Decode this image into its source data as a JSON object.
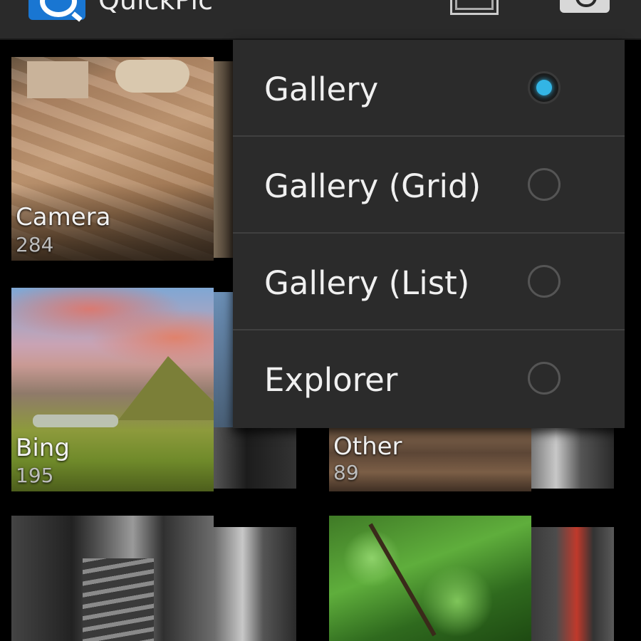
{
  "app": {
    "title": "QuickPic"
  },
  "albums": [
    {
      "name": "Camera",
      "count": "284"
    },
    {
      "name": "Bing",
      "count": "195"
    },
    {
      "name": "Other",
      "count": "89"
    }
  ],
  "view_menu": {
    "options": [
      {
        "label": "Gallery",
        "selected": true
      },
      {
        "label": "Gallery (Grid)",
        "selected": false
      },
      {
        "label": "Gallery (List)",
        "selected": false
      },
      {
        "label": "Explorer",
        "selected": false
      }
    ],
    "accent_color": "#33b5e5"
  },
  "colors": {
    "action_bar": "#2a2a2a",
    "menu_bg": "#2b2b2b",
    "divider": "#404040"
  },
  "icons": [
    "app-logo-icon",
    "view-mode-icon",
    "camera-icon"
  ]
}
